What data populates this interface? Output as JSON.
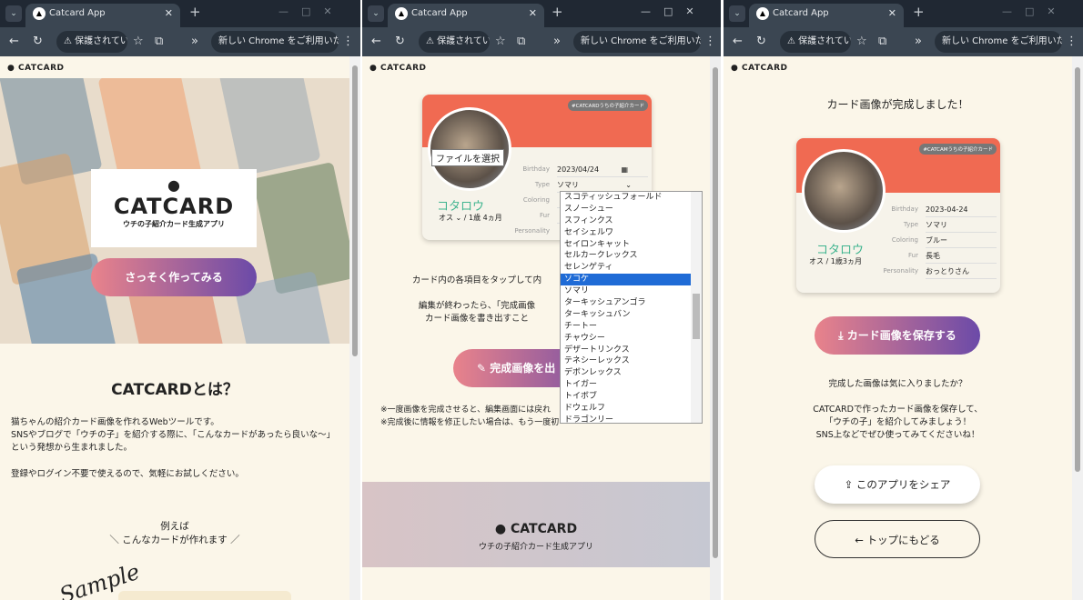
{
  "browser": {
    "tab_title": "Catcard App",
    "security_label": "保護されてい",
    "update_text": "新しい Chrome をご利用いただけます"
  },
  "brand": "CATCARD",
  "w1": {
    "hero_logo": "CATCARD",
    "hero_sub": "ウチの子紹介カード生成アプリ",
    "cta": "さっそく作ってみる",
    "about_title": "CATCARDとは？",
    "about_p1": "猫ちゃんの紹介カード画像を作れるWebツールです。",
    "about_p2": "SNSやブログで「ウチの子」を紹介する際に、「こんなカードがあったら良いな〜」という発想から生まれました。",
    "about_p3": "登録やログイン不要で使えるので、気軽にお試しください。",
    "eg1": "例えば",
    "eg2": "＼ こんなカードが作れます ／",
    "sample": "Sample"
  },
  "w2": {
    "badge": "#CATCARDうちの子紹介カード",
    "file_btn": "ファイルを選択",
    "birthday_label": "Birthday",
    "birthday_value": "2023/04/24",
    "type_label": "Type",
    "type_value": "ソマリ",
    "coloring_label": "Coloring",
    "fur_label": "Fur",
    "personality_label": "Personality",
    "name": "コタロウ",
    "sex": "オス",
    "age": "/ 1歳 4ヵ月",
    "breeds": [
      "スコティッシュフォールド",
      "スノーシュー",
      "スフィンクス",
      "セイシェルワ",
      "セイロンキャット",
      "セルカークレックス",
      "セレンゲティ",
      "ソコケ",
      "ソマリ",
      "ターキッシュアンゴラ",
      "ターキッシュバン",
      "チートー",
      "チャウシー",
      "デザートリンクス",
      "テネシーレックス",
      "デボンレックス",
      "トイガー",
      "トイボブ",
      "ドウェルフ",
      "ドラゴンリー"
    ],
    "selected_index": 7,
    "hint1": "カード内の各項目をタップして内",
    "hint2": "編集が終わったら、「完成画像",
    "hint3": "カード画像を書き出すこと",
    "make_btn": "完成画像を出",
    "note1": "※一度画像を完成させると、編集画面には戻れ",
    "note2": "※完成後に情報を修正したい場合は、もう一度初",
    "footer_logo": "CATCARD",
    "footer_sub": "ウチの子紹介カード生成アプリ"
  },
  "w3": {
    "done": "カード画像が完成しました！",
    "badge": "#CATCAMうちの子紹介カード",
    "name": "コタロウ",
    "sex_age": "オス / 1歳3ヵ月",
    "fields": [
      {
        "label": "Birthday",
        "value": "2023-04-24"
      },
      {
        "label": "Type",
        "value": "ソマリ"
      },
      {
        "label": "Coloring",
        "value": "ブルー"
      },
      {
        "label": "Fur",
        "value": "長毛"
      },
      {
        "label": "Personality",
        "value": "おっとりさん"
      }
    ],
    "save_btn": "カード画像を保存する",
    "q": "完成した画像は気に入りましたか？",
    "share1": "CATCARDで作ったカード画像を保存して、",
    "share2": "「ウチの子」を紹介してみましょう！",
    "share3": "SNS上などでぜひ使ってみてくださいね！",
    "share_btn": "このアプリをシェア",
    "back_btn": "トップにもどる"
  }
}
